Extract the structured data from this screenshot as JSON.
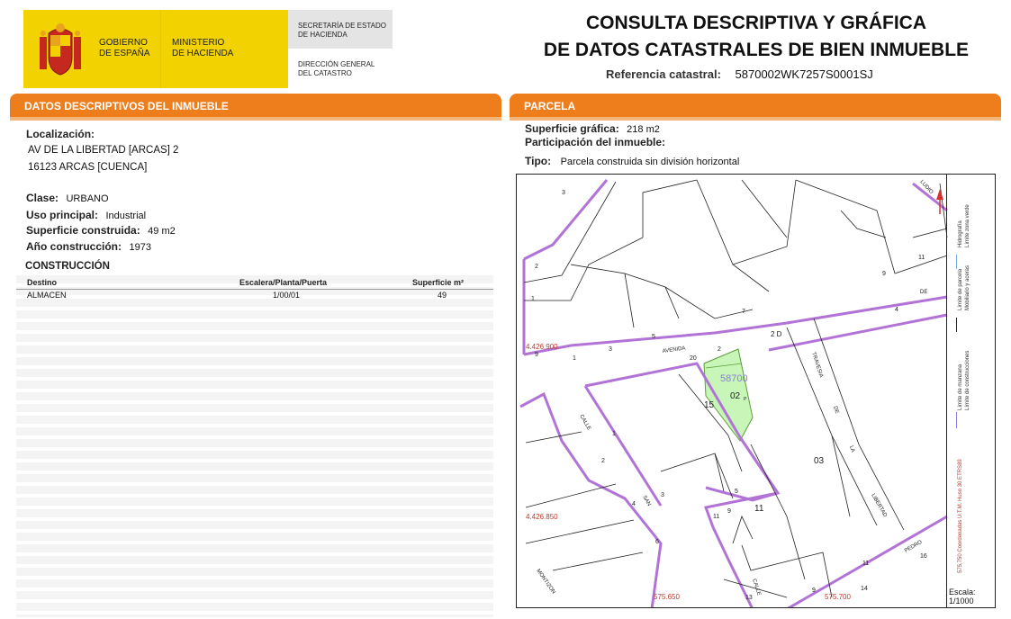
{
  "header": {
    "gov_line1": "GOBIERNO",
    "gov_line2": "DE ESPAÑA",
    "min_line1": "MINISTERIO",
    "min_line2": "DE HACIENDA",
    "sec_line1": "SECRETARÍA DE ESTADO",
    "sec_line2": "DE HACIENDA",
    "dir_line1": "DIRECCIÓN GENERAL",
    "dir_line2": "DEL CATASTRO",
    "title_line1": "CONSULTA DESCRIPTIVA Y GRÁFICA",
    "title_line2": "DE DATOS CATASTRALES DE BIEN INMUEBLE",
    "ref_label": "Referencia catastral:",
    "ref_value": "5870002WK7257S0001SJ"
  },
  "left": {
    "section_title": "DATOS DESCRIPTIVOS DEL INMUEBLE",
    "loc_label": "Localización:",
    "loc_line1": "AV DE LA LIBERTAD [ARCAS] 2",
    "loc_line2": "16123 ARCAS [CUENCA]",
    "clase_label": "Clase:",
    "clase_value": "URBANO",
    "uso_label": "Uso principal:",
    "uso_value": "Industrial",
    "sup_label": "Superficie construida:",
    "sup_value": "49 m2",
    "anio_label": "Año construcción:",
    "anio_value": "1973",
    "construccion_title": "CONSTRUCCIÓN",
    "table": {
      "headers": [
        "Destino",
        "Escalera/Planta/Puerta",
        "Superficie m²"
      ],
      "rows": [
        [
          "ALMACEN",
          "1/00/01",
          "49"
        ]
      ]
    }
  },
  "right": {
    "section_title": "PARCELA",
    "supg_label": "Superficie gráfica:",
    "supg_value": "218 m2",
    "part_label": "Participación del inmueble:",
    "tipo_label": "Tipo:",
    "tipo_value": "Parcela construida sin división horizontal"
  },
  "map": {
    "street_labels": [
      "AVENIDA",
      "2 D",
      "DE",
      "CALLE",
      "SAN",
      "TRAVESIA",
      "DE",
      "LA",
      "LIBERTAD",
      "PEDRO",
      "MONTIZON",
      "CALLE",
      "LUDIO"
    ],
    "parcel_ref": "58700",
    "parcel_id": "02",
    "parcel_sub": "P",
    "block_nums": [
      "15",
      "03",
      "11"
    ],
    "house_nums": [
      "2",
      "1",
      "5",
      "7",
      "4",
      "9",
      "11",
      "20",
      "3",
      "1",
      "2",
      "3",
      "4",
      "5",
      "6",
      "9",
      "11",
      "11",
      "13",
      "14",
      "16",
      "9",
      "9",
      "1",
      "2",
      "3"
    ],
    "coord_y1": "4.426.900",
    "coord_y2": "4.426.850",
    "coord_x1": "575.650",
    "coord_x2": "575.700",
    "north_label": "N",
    "legend": {
      "limite_manzana": "Límite de manzana",
      "limite_parcela": "Límite de parcela",
      "limite_construcciones": "Límite de construcciones",
      "mobiliario": "Mobiliario y aceras",
      "limite_zona_verde": "Límite zona verde",
      "hidrografia": "Hidrografía",
      "coords_note": "575,750 Coordenadas U.T.M. Huso 30 ETRS89"
    },
    "scale_label": "Escala:",
    "scale_value": "1/1000"
  },
  "colors": {
    "orange": "#ee7d1c",
    "yellow": "#f2d200",
    "purple": "#b273d6",
    "parcel_green": "#c8f5b8",
    "coord_red": "#c0392b"
  }
}
